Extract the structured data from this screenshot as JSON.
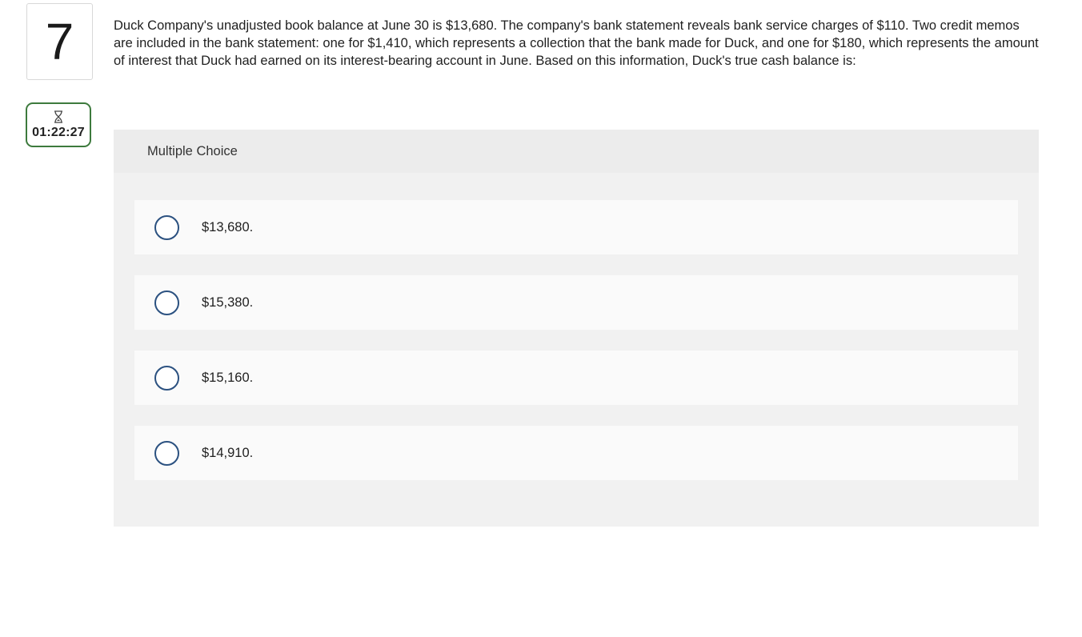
{
  "question": {
    "number": "7",
    "text": "Duck Company's unadjusted book balance at June 30 is $13,680. The company's bank statement reveals bank service charges of $110. Two credit memos are included in the bank statement: one for $1,410, which represents a collection that the bank made for Duck, and one for $180, which represents the amount of interest that Duck had earned on its interest-bearing account in June. Based on this information, Duck's true cash balance is:"
  },
  "timer": {
    "icon": "hourglass-icon",
    "time": "01:22:27",
    "border_color": "#3d7a3d"
  },
  "multiple_choice": {
    "header": "Multiple Choice",
    "radio_color": "#2b5180",
    "options": [
      {
        "label": "$13,680."
      },
      {
        "label": "$15,380."
      },
      {
        "label": "$15,160."
      },
      {
        "label": "$14,910."
      }
    ]
  }
}
